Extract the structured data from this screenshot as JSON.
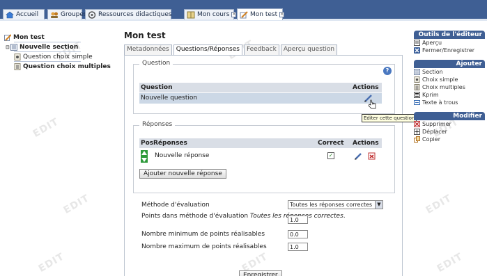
{
  "tabs": [
    {
      "label": "Accueil"
    },
    {
      "label": "Groupes"
    },
    {
      "label": "Ressources didactiques"
    },
    {
      "label": "Mon cours"
    },
    {
      "label": "Mon test"
    }
  ],
  "tree": {
    "root": "Mon test",
    "section": "Nouvelle section",
    "items": [
      "Question choix simple",
      "Question choix multiples"
    ]
  },
  "main": {
    "title": "Mon test",
    "content_tabs": [
      "Metadonnées",
      "Questions/Réponses",
      "Feedback",
      "Aperçu question"
    ],
    "question_legend": "Question",
    "question_table": {
      "header": {
        "question": "Question",
        "actions": "Actions"
      },
      "row": "Nouvelle question"
    },
    "tooltip": "Editer cette question",
    "answers_legend": "Réponses",
    "answers_table": {
      "header": {
        "pos": "Pos",
        "reponses": "Réponses",
        "correct": "Correct",
        "actions": "Actions"
      },
      "row": "Nouvelle réponse"
    },
    "add_answer_button": "Ajouter nouvelle réponse",
    "eval_method_label": "Méthode d'évaluation",
    "eval_method_value": "Toutes les réponses correctes",
    "points_label_1": "Points dans méthode d'évaluation ",
    "points_label_italic": "Toutes les réponses correctes",
    "points_label_end": ".",
    "points_value": "1.0",
    "min_points_label": "Nombre minimum de points réalisables",
    "min_points_value": "0.0",
    "max_points_label": "Nombre maximum de points réalisables",
    "max_points_value": "1.0",
    "save_button": "Enregistrer"
  },
  "sidebar": {
    "tools_title": "Outils de l'éditeur",
    "tools": [
      "Aperçu",
      "Fermer/Enregistrer"
    ],
    "add_title": "Ajouter",
    "add": [
      "Section",
      "Choix simple",
      "Choix multiples",
      "Kprim",
      "Texte à trous"
    ],
    "modify_title": "Modifier",
    "modify": [
      "Supprimer",
      "Déplacer",
      "Copier"
    ]
  },
  "watermark": "EDIT",
  "colors": {
    "header": "#3f5f94",
    "table_header": "#d9dee6",
    "selected_row": "#ccd8e6"
  }
}
